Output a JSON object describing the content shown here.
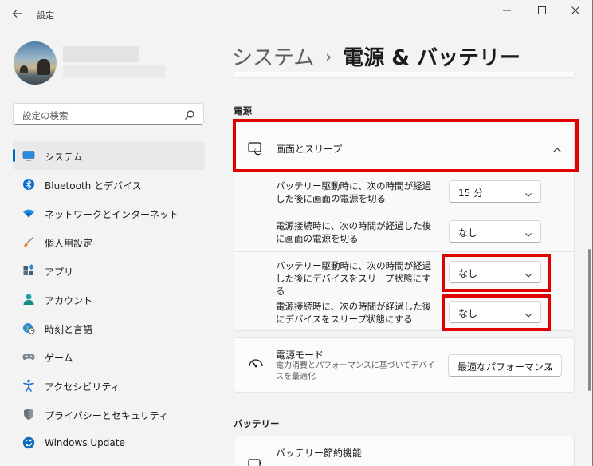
{
  "window": {
    "title": "設定",
    "back_icon": "back-arrow-icon",
    "minimize_icon": "minimize-icon",
    "maximize_icon": "maximize-icon",
    "close_icon": "close-icon"
  },
  "search": {
    "placeholder": "設定の検索",
    "icon": "search-icon"
  },
  "nav": {
    "items": [
      {
        "label": "システム",
        "icon": "monitor-icon",
        "selected": true
      },
      {
        "label": "Bluetooth とデバイス",
        "icon": "bluetooth-icon"
      },
      {
        "label": "ネットワークとインターネット",
        "icon": "wifi-icon"
      },
      {
        "label": "個人用設定",
        "icon": "brush-icon"
      },
      {
        "label": "アプリ",
        "icon": "apps-icon"
      },
      {
        "label": "アカウント",
        "icon": "person-icon"
      },
      {
        "label": "時刻と言語",
        "icon": "globe-clock-icon"
      },
      {
        "label": "ゲーム",
        "icon": "gamepad-icon"
      },
      {
        "label": "アクセシビリティ",
        "icon": "accessibility-icon"
      },
      {
        "label": "プライバシーとセキュリティ",
        "icon": "shield-icon"
      },
      {
        "label": "Windows Update",
        "icon": "update-icon"
      }
    ]
  },
  "breadcrumb": {
    "parent": "システム",
    "separator": "›",
    "current": "電源 & バッテリー"
  },
  "power": {
    "section_title": "電源",
    "screen_sleep": {
      "label": "画面とスリープ",
      "icon": "screen-sleep-icon",
      "expanded": true,
      "rows": [
        {
          "text": "バッテリー駆動時に、次の時間が経過した後に画面の電源を切る",
          "value": "15 分"
        },
        {
          "text": "電源接続時に、次の時間が経過した後に画面の電源を切る",
          "value": "なし"
        },
        {
          "text": "バッテリー駆動時に、次の時間が経過した後にデバイスをスリープ状態にする",
          "value": "なし"
        },
        {
          "text": "電源接続時に、次の時間が経過した後にデバイスをスリープ状態にする",
          "value": "なし"
        }
      ]
    },
    "power_mode": {
      "label": "電源モード",
      "description": "電力消費とパフォーマンスに基づいてデバイスを最適化",
      "value": "最適なパフォーマンス",
      "icon": "power-mode-icon"
    }
  },
  "battery": {
    "section_title": "バッテリー",
    "saver": {
      "label": "バッテリー節約機能",
      "icon": "battery-saver-icon"
    }
  },
  "colors": {
    "accent": "#0067c0",
    "highlight": "#e00000"
  }
}
